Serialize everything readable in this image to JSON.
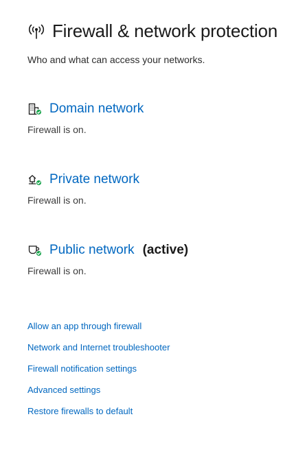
{
  "header": {
    "title": "Firewall & network protection",
    "icon": "antenna-broadcast-icon",
    "subtitle": "Who and what can access your networks."
  },
  "networks": [
    {
      "name": "Domain network",
      "icon": "domain-building-icon",
      "status": "Firewall is on.",
      "active_label": ""
    },
    {
      "name": "Private network",
      "icon": "private-home-network-icon",
      "status": "Firewall is on.",
      "active_label": ""
    },
    {
      "name": "Public network",
      "icon": "public-cafe-network-icon",
      "status": "Firewall is on.",
      "active_label": "(active)"
    }
  ],
  "links": [
    "Allow an app through firewall",
    "Network and Internet troubleshooter",
    "Firewall notification settings",
    "Advanced settings",
    "Restore firewalls to default"
  ],
  "colors": {
    "link": "#0067c0",
    "status_ok": "#16a34a",
    "text": "#1a1a1a"
  }
}
